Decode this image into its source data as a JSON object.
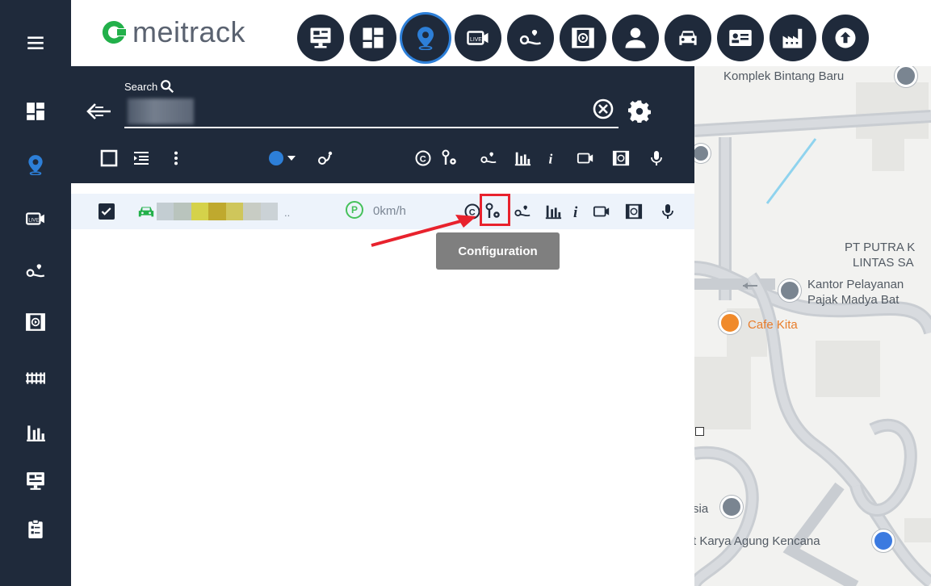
{
  "brand": {
    "name": "meitrack",
    "mark_color": "#22b04a",
    "text_color": "#5a6270"
  },
  "colors": {
    "sidebar_bg": "#1f2a3b",
    "accent_blue": "#2d7fd8",
    "moving_green": "#22b04a",
    "highlight_red": "#e8222d",
    "tooltip_bg": "#7f7f7f"
  },
  "sidebar": {
    "items": [
      {
        "icon": "menu-icon"
      },
      {
        "icon": "dashboard-icon"
      },
      {
        "icon": "location-pin-icon"
      },
      {
        "icon": "live-video-icon"
      },
      {
        "icon": "playback-route-icon"
      },
      {
        "icon": "video-playback-icon"
      },
      {
        "icon": "fence-icon"
      },
      {
        "icon": "report-chart-icon"
      },
      {
        "icon": "monitor-icon"
      },
      {
        "icon": "task-clipboard-icon"
      }
    ]
  },
  "top_nav": {
    "active_index": 2,
    "items": [
      {
        "icon": "monitor-icon"
      },
      {
        "icon": "dashboard-icon"
      },
      {
        "icon": "location-pin-icon"
      },
      {
        "icon": "live-video-icon"
      },
      {
        "icon": "playback-route-icon"
      },
      {
        "icon": "video-playback-icon"
      },
      {
        "icon": "user-icon"
      },
      {
        "icon": "car-icon"
      },
      {
        "icon": "id-card-icon"
      },
      {
        "icon": "factory-icon"
      },
      {
        "icon": "upload-icon"
      }
    ]
  },
  "search": {
    "label": "Search",
    "value": ""
  },
  "toolbar": {
    "status_color": "#2d7fd8"
  },
  "vehicle_row": {
    "checked": true,
    "name_hidden": "..",
    "speed": "0km/h",
    "parking_symbol": "P"
  },
  "tooltip": {
    "text": "Configuration"
  },
  "map": {
    "labels": {
      "komplek": "Komplek Bintang Baru",
      "pt_putra_1": "PT PUTRA K",
      "pt_putra_2": "LINTAS SA",
      "kantor_1": "Kantor Pelayanan",
      "kantor_2": "Pajak Madya Bat",
      "cafe": "Cafe Kita",
      "sia": "sia",
      "karya": "t Karya Agung Kencana"
    }
  }
}
